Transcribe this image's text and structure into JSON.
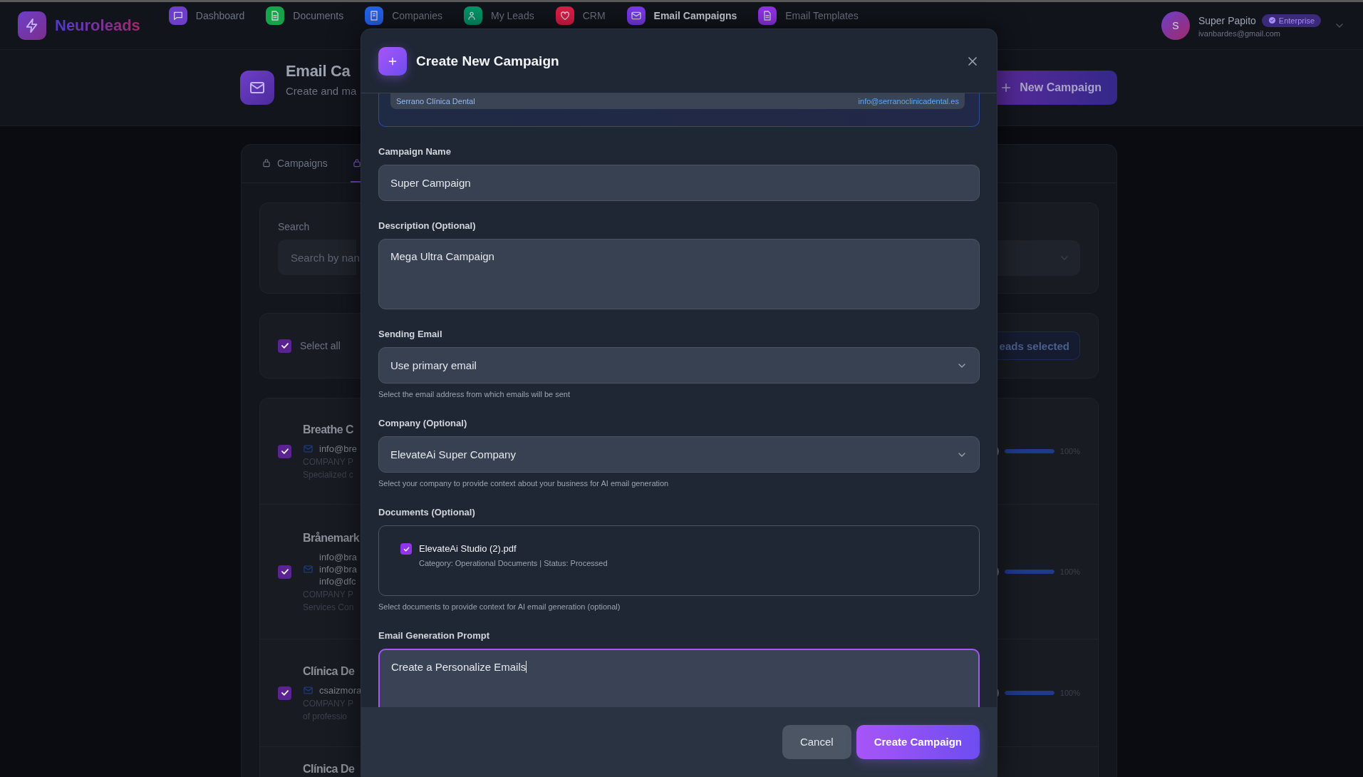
{
  "app": {
    "name": "Neuroleads"
  },
  "nav": [
    {
      "label": "Dashboard",
      "color": "#6d3fc8",
      "selected": false
    },
    {
      "label": "Documents",
      "color": "#16a34a",
      "selected": false
    },
    {
      "label": "Companies",
      "color": "#2563eb",
      "selected": false
    },
    {
      "label": "My Leads",
      "color": "#059669",
      "selected": false
    },
    {
      "label": "CRM",
      "color": "#e11d48",
      "selected": false
    },
    {
      "label": "Email Campaigns",
      "color": "#7c3aed",
      "selected": true
    },
    {
      "label": "Email Templates",
      "color": "#9333ea",
      "selected": false
    }
  ],
  "user": {
    "initial": "S",
    "name": "Super Papito",
    "plan": "Enterprise",
    "email": "ivanbardes@gmail.com"
  },
  "page_header": {
    "title": "Email Ca",
    "subtitle": "Create and ma",
    "new_button": "New Campaign"
  },
  "tabs": [
    {
      "label": "Campaigns",
      "selected": false
    },
    {
      "selected": true
    }
  ],
  "filters": {
    "search_label": "Search",
    "search_placeholder": "Search by nan"
  },
  "selection": {
    "select_all": "Select all",
    "checked": true,
    "count_badge": "eads selected"
  },
  "leads": [
    {
      "name": "Breathe C",
      "checked": true,
      "emails": [
        "info@bre"
      ],
      "details": [
        "COMPANY P",
        "Specialized c"
      ],
      "level": 1,
      "reading": "100%"
    },
    {
      "name": "Brånemark",
      "checked": true,
      "emails": [
        "info@bra",
        "info@bra",
        "info@dfc"
      ],
      "details": [
        "COMPANY P",
        "Services Con"
      ],
      "level": 1,
      "reading": "100%"
    },
    {
      "name": "Clínica De",
      "checked": true,
      "emails": [
        "csaizmora"
      ],
      "details": [
        "COMPANY P",
        "of professio"
      ],
      "level": 1,
      "reading": "100%"
    },
    {
      "name": "Clínica De"
    }
  ],
  "modal": {
    "title": "Create New Campaign",
    "recipient": {
      "name": "Serrano Clínica Dental",
      "email": "info@serranoclinicadental.es"
    },
    "fields": [
      {
        "kind": "input",
        "label": "Campaign Name",
        "value": "Super Campaign"
      },
      {
        "kind": "textarea",
        "label": "Description (Optional)",
        "value": "Mega Ultra Campaign",
        "focused": false
      },
      {
        "kind": "select",
        "label": "Sending Email",
        "value": "Use primary email",
        "help": "Select the email address from which emails will be sent"
      },
      {
        "kind": "select",
        "label": "Company (Optional)",
        "value": "ElevateAi Super Company",
        "help": "Select your company to provide context about your business for AI email generation"
      },
      {
        "kind": "documents",
        "label": "Documents (Optional)",
        "documents": [
          {
            "name": "ElevateAi Studio (2).pdf",
            "meta": "Category: Operational Documents | Status: Processed",
            "checked": true
          }
        ],
        "help": "Select documents to provide context for AI email generation (optional)"
      },
      {
        "kind": "textarea",
        "label": "Email Generation Prompt",
        "value": "Create a Personalize Emails",
        "focused": true
      }
    ],
    "buttons": [
      {
        "kind": "secondary",
        "label": "Cancel"
      },
      {
        "kind": "primary",
        "label": "Create Campaign"
      }
    ]
  }
}
